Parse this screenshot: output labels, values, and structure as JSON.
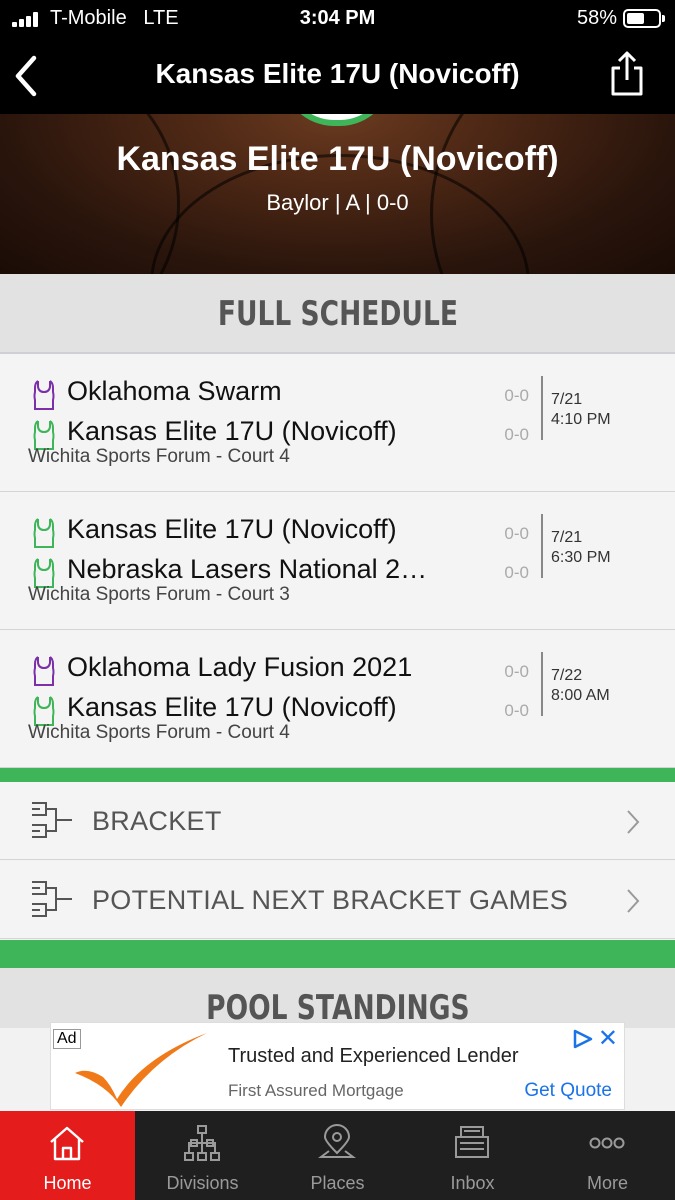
{
  "status_bar": {
    "carrier": "T-Mobile",
    "network": "LTE",
    "time": "3:04 PM",
    "battery": "58%",
    "battery_level": 0.58
  },
  "nav": {
    "title": "Kansas Elite 17U (Novicoff)",
    "back_icon": "chevron-left-icon",
    "share_icon": "share-icon"
  },
  "hero": {
    "team_name": "Kansas Elite 17U (Novicoff)",
    "subtitle": "Baylor | A | 0-0"
  },
  "schedule": {
    "title": "FULL SCHEDULE",
    "games": [
      {
        "team1": {
          "name": "Oklahoma Swarm",
          "jersey_color": "#7b2fa8",
          "score": "0-0"
        },
        "team2": {
          "name": "Kansas Elite 17U (Novicoff)",
          "jersey_color": "#3fb55a",
          "score": "0-0"
        },
        "date": "7/21",
        "time": "4:10 PM",
        "venue": "Wichita Sports Forum - Court 4"
      },
      {
        "team1": {
          "name": "Kansas Elite 17U (Novicoff)",
          "jersey_color": "#3fb55a",
          "score": "0-0"
        },
        "team2": {
          "name": "Nebraska Lasers National 2…",
          "jersey_color": "#3fb55a",
          "score": "0-0"
        },
        "date": "7/21",
        "time": "6:30 PM",
        "venue": "Wichita Sports Forum - Court 3"
      },
      {
        "team1": {
          "name": "Oklahoma Lady Fusion 2021",
          "jersey_color": "#7b2fa8",
          "score": "0-0"
        },
        "team2": {
          "name": "Kansas Elite 17U (Novicoff)",
          "jersey_color": "#3fb55a",
          "score": "0-0"
        },
        "date": "7/22",
        "time": "8:00 AM",
        "venue": "Wichita Sports Forum - Court 4"
      }
    ]
  },
  "brackets": [
    {
      "label": "BRACKET",
      "icon": "bracket-icon"
    },
    {
      "label": "POTENTIAL NEXT BRACKET GAMES",
      "icon": "bracket-icon"
    }
  ],
  "pool_standings": {
    "title": "POOL STANDINGS"
  },
  "ad": {
    "badge": "Ad",
    "title": "Trusted and Experienced Lender",
    "advertiser": "First Assured Mortgage",
    "cta": "Get Quote",
    "close": "✕"
  },
  "tabs": [
    {
      "label": "Home",
      "icon": "home-icon",
      "active": true
    },
    {
      "label": "Divisions",
      "icon": "divisions-icon",
      "active": false
    },
    {
      "label": "Places",
      "icon": "map-pin-icon",
      "active": false
    },
    {
      "label": "Inbox",
      "icon": "inbox-icon",
      "active": false
    },
    {
      "label": "More",
      "icon": "more-icon",
      "active": false
    }
  ],
  "colors": {
    "accent_green": "#3fb55a",
    "active_tab": "#e51c1c",
    "jersey_purple": "#7b2fa8",
    "link_blue": "#1a73e8"
  }
}
